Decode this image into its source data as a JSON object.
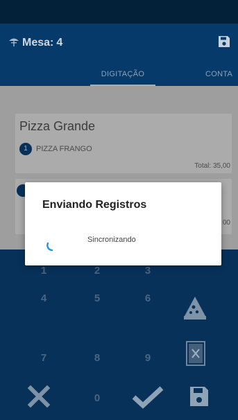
{
  "app_bar": {
    "title_prefix": "Mesa:",
    "table_number": "4"
  },
  "tabs": [
    {
      "label": "DIGITAÇÃO"
    },
    {
      "label": "CONTA"
    }
  ],
  "order": {
    "cards": [
      {
        "title": "Pizza Grande",
        "items": [
          {
            "qty": "1",
            "name": "PIZZA FRANGO"
          }
        ],
        "total": "Total: 35,00"
      },
      {
        "qty": "",
        "total_partial": "00"
      }
    ]
  },
  "keypad": {
    "keys": [
      "1",
      "2",
      "3",
      "4",
      "5",
      "6",
      "7",
      "8",
      "9",
      "0"
    ],
    "actions": [
      "cancel-icon",
      "confirm-icon",
      "save-icon",
      "pizza-icon",
      "menu-book-icon"
    ]
  },
  "dialog": {
    "title": "Enviando Registros",
    "message": "Sincronizando"
  },
  "colors": {
    "primary": "#053a6a",
    "status_bar": "#04213a",
    "keypad": "#08315a",
    "accent": "#2196f3"
  }
}
